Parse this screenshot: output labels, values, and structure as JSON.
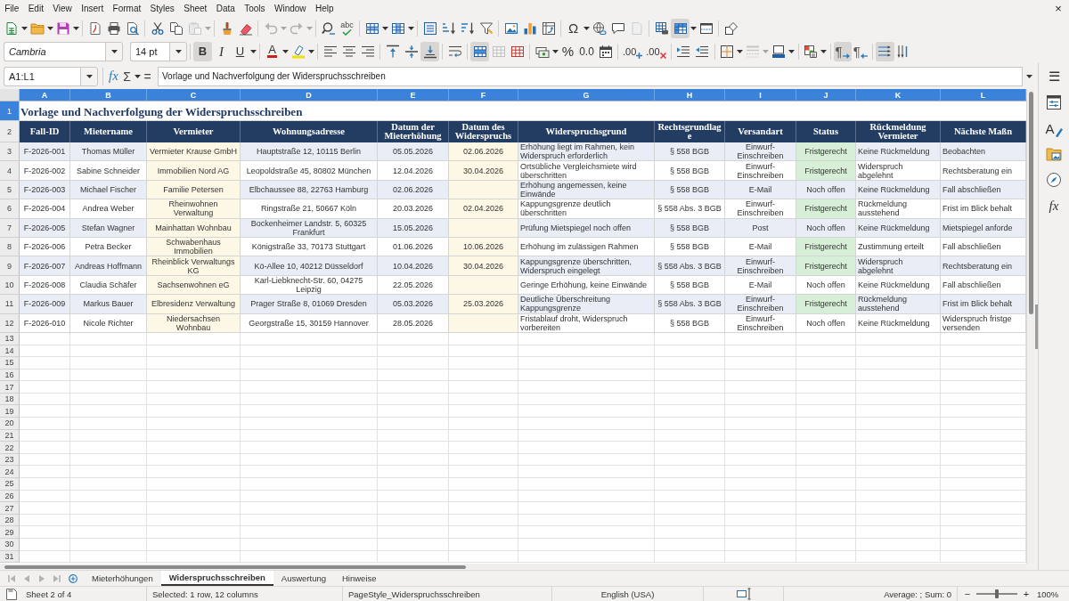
{
  "menu_bar": {
    "items": [
      "File",
      "Edit",
      "View",
      "Insert",
      "Format",
      "Styles",
      "Sheet",
      "Data",
      "Tools",
      "Window",
      "Help"
    ],
    "close": "×"
  },
  "standard_toolbar": [
    [
      {
        "pressed": false,
        "disabled": false,
        "dropdown": true
      },
      {
        "pressed": false,
        "disabled": false,
        "dropdown": true
      },
      {
        "pressed": false,
        "disabled": false,
        "dropdown": true
      }
    ],
    [
      {
        "pressed": false,
        "disabled": false,
        "dropdown": false
      },
      {
        "pressed": false,
        "disabled": false,
        "dropdown": false
      },
      {
        "pressed": false,
        "disabled": false,
        "dropdown": false
      }
    ],
    [
      {
        "pressed": false,
        "disabled": false,
        "dropdown": false
      },
      {
        "pressed": false,
        "disabled": false,
        "dropdown": false
      },
      {
        "pressed": false,
        "disabled": true,
        "dropdown": true
      }
    ],
    [
      {
        "pressed": false,
        "disabled": false,
        "dropdown": false
      },
      {
        "pressed": false,
        "disabled": false,
        "dropdown": false
      }
    ],
    [
      {
        "pressed": false,
        "disabled": true,
        "dropdown": true
      },
      {
        "pressed": false,
        "disabled": true,
        "dropdown": true
      }
    ],
    [
      {
        "pressed": false,
        "disabled": false,
        "dropdown": false
      },
      {
        "pressed": false,
        "disabled": false,
        "dropdown": false,
        "glyph": "abc"
      }
    ],
    [
      {
        "pressed": false,
        "disabled": false,
        "dropdown": true
      },
      {
        "pressed": false,
        "disabled": false,
        "dropdown": true
      }
    ],
    [
      {
        "pressed": false,
        "disabled": false,
        "dropdown": false
      },
      {
        "pressed": false,
        "disabled": false,
        "dropdown": false
      },
      {
        "pressed": false,
        "disabled": false,
        "dropdown": false
      },
      {
        "pressed": false,
        "disabled": false,
        "dropdown": false
      }
    ],
    [
      {
        "pressed": false,
        "disabled": false,
        "dropdown": false
      },
      {
        "pressed": false,
        "disabled": false,
        "dropdown": false
      },
      {
        "pressed": false,
        "disabled": false,
        "dropdown": false
      }
    ],
    [
      {
        "pressed": false,
        "disabled": false,
        "dropdown": true,
        "glyph": "Ω"
      },
      {
        "pressed": false,
        "disabled": false,
        "dropdown": false
      },
      {
        "pressed": false,
        "disabled": false,
        "dropdown": false
      },
      {
        "pressed": false,
        "disabled": true,
        "dropdown": false
      }
    ],
    [
      {
        "pressed": false,
        "disabled": false,
        "dropdown": false
      },
      {
        "pressed": true,
        "disabled": false,
        "dropdown": true
      },
      {
        "pressed": false,
        "disabled": false,
        "dropdown": false
      }
    ],
    [
      {
        "pressed": false,
        "disabled": false,
        "dropdown": false
      }
    ]
  ],
  "formatting_toolbar": {
    "font_name": "Cambria",
    "font_size": "14 pt",
    "groups": [
      [
        {
          "pressed": true,
          "disabled": false,
          "dropdown": false,
          "glyph": "B"
        },
        {
          "pressed": false,
          "disabled": false,
          "dropdown": false,
          "glyph": "I"
        },
        {
          "pressed": false,
          "disabled": false,
          "dropdown": true,
          "glyph": "U"
        }
      ],
      [
        {
          "pressed": false,
          "disabled": false,
          "dropdown": true,
          "glyph": "A"
        },
        {
          "pressed": false,
          "disabled": false,
          "dropdown": true
        }
      ],
      [
        {
          "pressed": false,
          "disabled": false,
          "dropdown": false
        },
        {
          "pressed": false,
          "disabled": false,
          "dropdown": false
        },
        {
          "pressed": false,
          "disabled": false,
          "dropdown": false
        }
      ],
      [
        {
          "pressed": false,
          "disabled": false,
          "dropdown": false
        },
        {
          "pressed": false,
          "disabled": false,
          "dropdown": false
        },
        {
          "pressed": true,
          "disabled": false,
          "dropdown": false
        }
      ],
      [
        {
          "pressed": false,
          "disabled": false,
          "dropdown": false
        }
      ],
      [
        {
          "pressed": true,
          "disabled": false,
          "dropdown": false
        },
        {
          "pressed": false,
          "disabled": true,
          "dropdown": false
        },
        {
          "pressed": false,
          "disabled": false,
          "dropdown": false
        }
      ],
      [
        {
          "pressed": false,
          "disabled": false,
          "dropdown": true
        },
        {
          "pressed": false,
          "disabled": false,
          "dropdown": false,
          "glyph": "%"
        },
        {
          "pressed": false,
          "disabled": false,
          "dropdown": false,
          "glyph": "0.0"
        },
        {
          "pressed": false,
          "disabled": false,
          "dropdown": false
        }
      ],
      [
        {
          "pressed": false,
          "disabled": false,
          "dropdown": false,
          "glyph": ".00"
        },
        {
          "pressed": false,
          "disabled": false,
          "dropdown": false,
          "glyph": ".00"
        }
      ],
      [
        {
          "pressed": false,
          "disabled": false,
          "dropdown": false
        },
        {
          "pressed": false,
          "disabled": false,
          "dropdown": false
        }
      ],
      [
        {
          "pressed": false,
          "disabled": false,
          "dropdown": true
        },
        {
          "pressed": false,
          "disabled": true,
          "dropdown": true
        },
        {
          "pressed": false,
          "disabled": false,
          "dropdown": true
        }
      ],
      [
        {
          "pressed": false,
          "disabled": false,
          "dropdown": true
        }
      ],
      [
        {
          "pressed": true,
          "disabled": false,
          "dropdown": false,
          "glyph": "¶"
        },
        {
          "pressed": false,
          "disabled": false,
          "dropdown": false,
          "glyph": "¶"
        }
      ],
      [
        {
          "pressed": true,
          "disabled": false,
          "dropdown": false
        },
        {
          "pressed": false,
          "disabled": false,
          "dropdown": false
        }
      ]
    ]
  },
  "formula_bar": {
    "name_box": "A1:L1",
    "function_wizard": "fx",
    "sum": "Σ",
    "equals": "=",
    "content": "Vorlage und Nachverfolgung der Widerspruchsschreiben"
  },
  "sheet": {
    "columns": [
      {
        "letter": "A",
        "selected": true,
        "heading": "Fall-ID",
        "tinted": false
      },
      {
        "letter": "B",
        "selected": true,
        "heading": "Mietername",
        "tinted": false
      },
      {
        "letter": "C",
        "selected": true,
        "heading": "Vermieter",
        "tinted": true
      },
      {
        "letter": "D",
        "selected": true,
        "heading": "Wohnungsadresse",
        "tinted": false
      },
      {
        "letter": "E",
        "selected": true,
        "heading": "Datum der Mieterhöhung",
        "tinted": false
      },
      {
        "letter": "F",
        "selected": true,
        "heading": "Datum des Widerspruchs",
        "tinted": true
      },
      {
        "letter": "G",
        "selected": true,
        "heading": "Widerspruchsgrund",
        "tinted": false
      },
      {
        "letter": "H",
        "selected": true,
        "heading": "Rechtsgrundlage",
        "tinted": false
      },
      {
        "letter": "I",
        "selected": true,
        "heading": "Versandart",
        "tinted": false
      },
      {
        "letter": "J",
        "selected": true,
        "heading": "Status",
        "tinted": false
      },
      {
        "letter": "K",
        "selected": true,
        "heading": "Rückmeldung Vermieter",
        "tinted": false
      },
      {
        "letter": "L",
        "selected": true,
        "heading": "Nächste Maßn",
        "tinted": false
      }
    ],
    "title_row": {
      "number": "1",
      "selected": true,
      "title": "Vorlage und Nachverfolgung der Widerspruchsschreiben"
    },
    "heading_row": {
      "number": "2",
      "selected": false
    },
    "rows": [
      {
        "number": "3",
        "selected": false,
        "fall_id": "F-2026-001",
        "mietername": "Thomas Müller",
        "vermieter": "Vermieter Krause GmbH",
        "wohnungsadresse": "Hauptstraße 12, 10115 Berlin",
        "datum_mieterhoehung": "05.05.2026",
        "datum_widerspruch": "02.06.2026",
        "widerspruchsgrund": "Erhöhung liegt im Rahmen, kein Widerspruch erforderlich",
        "rechtsgrundlage": "§ 558 BGB",
        "versandart": "Einwurf-Einschreiben",
        "status": "Fristgerecht",
        "status_highlighted": true,
        "rueckmeldung_vermieter": "Keine Rückmeldung",
        "column_12": "Beobachten"
      },
      {
        "number": "4",
        "selected": false,
        "fall_id": "F-2026-002",
        "mietername": "Sabine Schneider",
        "vermieter": "Immobilien Nord AG",
        "wohnungsadresse": "Leopoldstraße 45, 80802 München",
        "datum_mieterhoehung": "12.04.2026",
        "datum_widerspruch": "30.04.2026",
        "widerspruchsgrund": "Ortsübliche Vergleichsmiete wird überschritten",
        "rechtsgrundlage": "§ 558 BGB",
        "versandart": "Einwurf-Einschreiben",
        "status": "Fristgerecht",
        "status_highlighted": true,
        "rueckmeldung_vermieter": "Widerspruch abgelehnt",
        "column_12": "Rechtsberatung ein"
      },
      {
        "number": "5",
        "selected": false,
        "fall_id": "F-2026-003",
        "mietername": "Michael Fischer",
        "vermieter": "Familie Petersen",
        "wohnungsadresse": "Elbchaussee 88, 22763 Hamburg",
        "datum_mieterhoehung": "02.06.2026",
        "widerspruchsgrund": "Erhöhung angemessen, keine Einwände",
        "rechtsgrundlage": "§ 558 BGB",
        "versandart": "E-Mail",
        "status": "Noch offen",
        "status_highlighted": false,
        "rueckmeldung_vermieter": "Keine Rückmeldung",
        "column_12": "Fall abschließen"
      },
      {
        "number": "6",
        "selected": false,
        "fall_id": "F-2026-004",
        "mietername": "Andrea Weber",
        "vermieter": "Rheinwohnen Verwaltung",
        "wohnungsadresse": "Ringstraße 21, 50667 Köln",
        "datum_mieterhoehung": "20.03.2026",
        "datum_widerspruch": "02.04.2026",
        "widerspruchsgrund": "Kappungsgrenze deutlich überschritten",
        "rechtsgrundlage": "§ 558 Abs. 3 BGB",
        "versandart": "Einwurf-Einschreiben",
        "status": "Fristgerecht",
        "status_highlighted": true,
        "rueckmeldung_vermieter": "Rückmeldung ausstehend",
        "column_12": "Frist im Blick behalt"
      },
      {
        "number": "7",
        "selected": false,
        "fall_id": "F-2026-005",
        "mietername": "Stefan Wagner",
        "vermieter": "Mainhattan Wohnbau",
        "wohnungsadresse": "Bockenheimer Landstr. 5, 60325 Frankfurt",
        "datum_mieterhoehung": "15.05.2026",
        "widerspruchsgrund": "Prüfung Mietspiegel noch offen",
        "rechtsgrundlage": "§ 558 BGB",
        "versandart": "Post",
        "status": "Noch offen",
        "status_highlighted": false,
        "rueckmeldung_vermieter": "Keine Rückmeldung",
        "column_12": "Mietspiegel anforde"
      },
      {
        "number": "8",
        "selected": false,
        "fall_id": "F-2026-006",
        "mietername": "Petra Becker",
        "vermieter": "Schwabenhaus Immobilien",
        "wohnungsadresse": "Königstraße 33, 70173 Stuttgart",
        "datum_mieterhoehung": "01.06.2026",
        "datum_widerspruch": "10.06.2026",
        "widerspruchsgrund": "Erhöhung im zulässigen Rahmen",
        "rechtsgrundlage": "§ 558 BGB",
        "versandart": "E-Mail",
        "status": "Fristgerecht",
        "status_highlighted": true,
        "rueckmeldung_vermieter": "Zustimmung erteilt",
        "column_12": "Fall abschließen"
      },
      {
        "number": "9",
        "selected": false,
        "fall_id": "F-2026-007",
        "mietername": "Andreas Hoffmann",
        "vermieter": "Rheinblick Verwaltungs KG",
        "wohnungsadresse": "Kö-Allee 10, 40212 Düsseldorf",
        "datum_mieterhoehung": "10.04.2026",
        "datum_widerspruch": "30.04.2026",
        "widerspruchsgrund": "Kappungsgrenze überschritten, Widerspruch eingelegt",
        "rechtsgrundlage": "§ 558 Abs. 3 BGB",
        "versandart": "Einwurf-Einschreiben",
        "status": "Fristgerecht",
        "status_highlighted": true,
        "rueckmeldung_vermieter": "Widerspruch abgelehnt",
        "column_12": "Rechtsberatung ein"
      },
      {
        "number": "10",
        "selected": false,
        "fall_id": "F-2026-008",
        "mietername": "Claudia Schäfer",
        "vermieter": "Sachsenwohnen eG",
        "wohnungsadresse": "Karl-Liebknecht-Str. 60, 04275 Leipzig",
        "datum_mieterhoehung": "22.05.2026",
        "widerspruchsgrund": "Geringe Erhöhung, keine Einwände",
        "rechtsgrundlage": "§ 558 BGB",
        "versandart": "E-Mail",
        "status": "Noch offen",
        "status_highlighted": false,
        "rueckmeldung_vermieter": "Keine Rückmeldung",
        "column_12": "Fall abschließen"
      },
      {
        "number": "11",
        "selected": false,
        "fall_id": "F-2026-009",
        "mietername": "Markus Bauer",
        "vermieter": "Elbresidenz Verwaltung",
        "wohnungsadresse": "Prager Straße 8, 01069 Dresden",
        "datum_mieterhoehung": "05.03.2026",
        "datum_widerspruch": "25.03.2026",
        "widerspruchsgrund": "Deutliche Überschreitung Kappungsgrenze",
        "rechtsgrundlage": "§ 558 Abs. 3 BGB",
        "versandart": "Einwurf-Einschreiben",
        "status": "Fristgerecht",
        "status_highlighted": true,
        "rueckmeldung_vermieter": "Rückmeldung ausstehend",
        "column_12": "Frist im Blick behalt"
      },
      {
        "number": "12",
        "selected": false,
        "fall_id": "F-2026-010",
        "mietername": "Nicole Richter",
        "vermieter": "Niedersachsen Wohnbau",
        "wohnungsadresse": "Georgstraße 15, 30159 Hannover",
        "datum_mieterhoehung": "28.05.2026",
        "widerspruchsgrund": "Fristablauf droht, Widerspruch vorbereiten",
        "rechtsgrundlage": "§ 558 BGB",
        "versandart": "Einwurf-Einschreiben",
        "status": "Noch offen",
        "status_highlighted": false,
        "rueckmeldung_vermieter": "Keine Rückmeldung",
        "column_12": "Widerspruch fristge versenden"
      }
    ],
    "empty_rows": [
      {
        "number": "13",
        "selected": false
      },
      {
        "number": "14",
        "selected": false
      },
      {
        "number": "15",
        "selected": false
      },
      {
        "number": "16",
        "selected": false
      },
      {
        "number": "17",
        "selected": false
      },
      {
        "number": "18",
        "selected": false
      },
      {
        "number": "19",
        "selected": false
      },
      {
        "number": "20",
        "selected": false
      },
      {
        "number": "21",
        "selected": false
      },
      {
        "number": "22",
        "selected": false
      },
      {
        "number": "23",
        "selected": false
      },
      {
        "number": "24",
        "selected": false
      },
      {
        "number": "25",
        "selected": false
      },
      {
        "number": "26",
        "selected": false
      },
      {
        "number": "27",
        "selected": false
      },
      {
        "number": "28",
        "selected": false
      },
      {
        "number": "29",
        "selected": false
      },
      {
        "number": "30",
        "selected": false
      },
      {
        "number": "31",
        "selected": false
      }
    ]
  },
  "sidebar": {
    "menu": "☰",
    "styles_glyph": "A",
    "functions_glyph": "fx"
  },
  "sheet_bar": {
    "nav_disabled": true,
    "tabs": [
      {
        "label": "Mieterhöhungen",
        "selected": false
      },
      {
        "label": "Widerspruchsschreiben",
        "selected": true
      },
      {
        "label": "Auswertung",
        "selected": false
      },
      {
        "label": "Hinweise",
        "selected": false
      }
    ]
  },
  "status_bar": {
    "sheet": "Sheet 2 of 4",
    "selection": "Selected: 1 row, 12 columns",
    "page_style": "PageStyle_Widerspruchsschreiben",
    "language": "English (USA)",
    "summary": "Average: ; Sum: 0",
    "zoom_out": "−",
    "zoom_slider": {
      "level": 0.5
    },
    "zoom_in": "+",
    "zoom": "100%"
  }
}
